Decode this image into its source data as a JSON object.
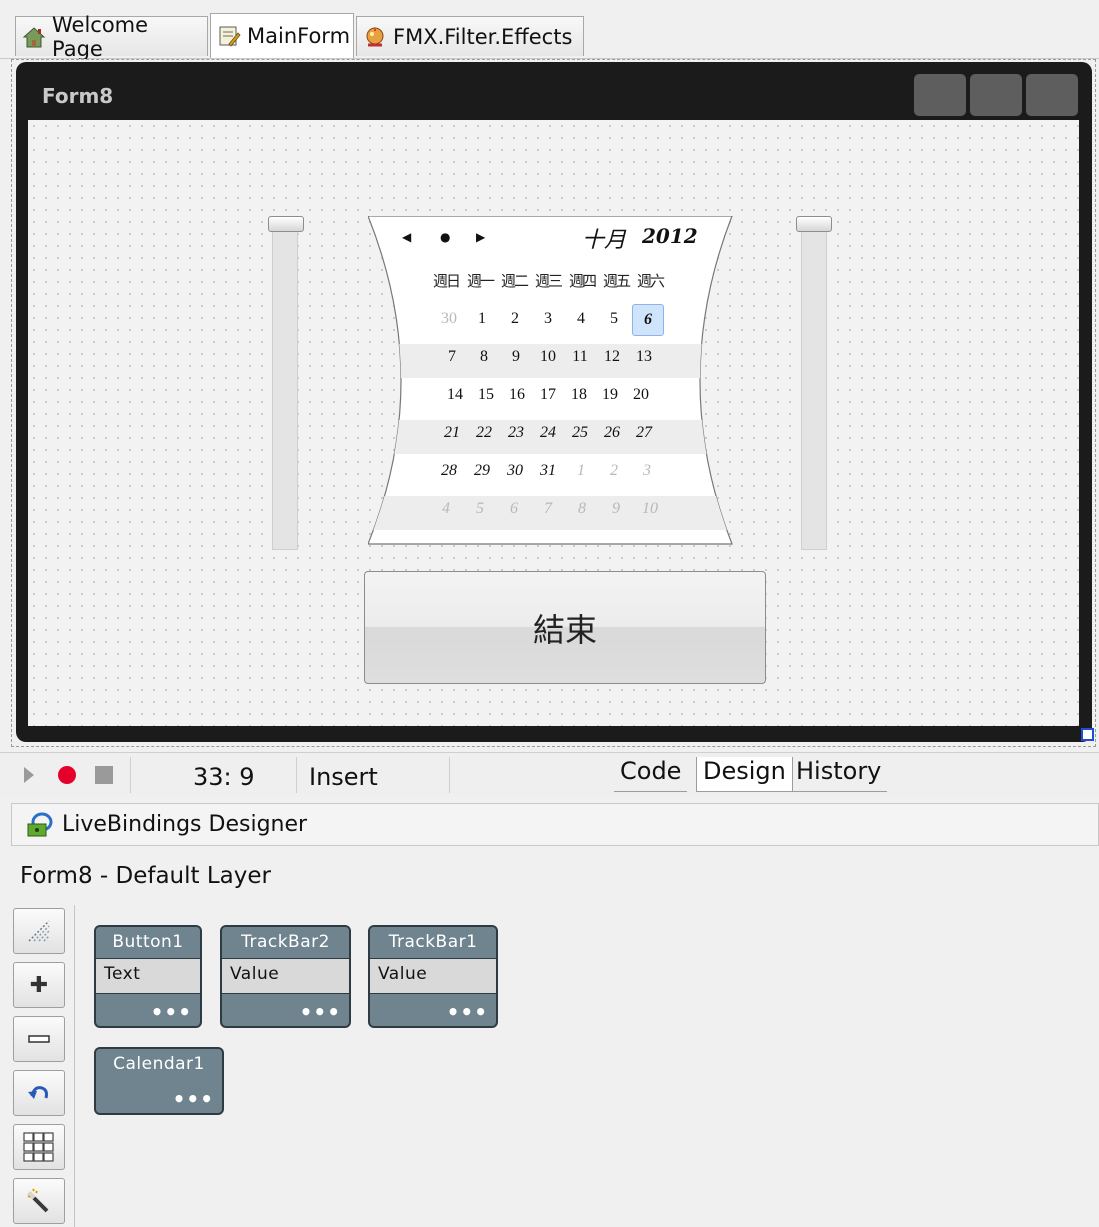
{
  "tabs": [
    {
      "label": "Welcome Page",
      "icon": "home-icon"
    },
    {
      "label": "MainForm",
      "icon": "form-icon",
      "active": true
    },
    {
      "label": "FMX.Filter.Effects",
      "icon": "effects-icon"
    }
  ],
  "form": {
    "title": "Form8",
    "calendar": {
      "month": "十月",
      "year": "2012",
      "day_names": [
        "週日",
        "週一",
        "週二",
        "週三",
        "週四",
        "週五",
        "週六"
      ],
      "weeks": [
        [
          "30",
          "1",
          "2",
          "3",
          "4",
          "5",
          "6"
        ],
        [
          "7",
          "8",
          "9",
          "10",
          "11",
          "12",
          "13"
        ],
        [
          "14",
          "15",
          "16",
          "17",
          "18",
          "19",
          "20"
        ],
        [
          "21",
          "22",
          "23",
          "24",
          "25",
          "26",
          "27"
        ],
        [
          "28",
          "29",
          "30",
          "31",
          "1",
          "2",
          "3"
        ],
        [
          "4",
          "5",
          "6",
          "7",
          "8",
          "9",
          "10"
        ]
      ],
      "selected_day": "6"
    },
    "trackbar_left_value": 0,
    "trackbar_right_value": 0,
    "end_button_label": "結束"
  },
  "statusbar": {
    "position": "33:  9",
    "mode": "Insert",
    "view_tabs": [
      "Code",
      "Design",
      "History"
    ],
    "active_view": "Design"
  },
  "livebindings": {
    "title": "LiveBindings Designer",
    "layer": "Form8  - Default Layer",
    "tool_icons": [
      "layout-icon",
      "zoom-in-icon",
      "zoom-out-icon",
      "undo-icon",
      "grid-icon",
      "wizard-icon"
    ],
    "objects": [
      {
        "name": "Button1",
        "property": "Text"
      },
      {
        "name": "TrackBar2",
        "property": "Value"
      },
      {
        "name": "TrackBar1",
        "property": "Value"
      },
      {
        "name": "Calendar1",
        "property": ""
      }
    ],
    "more_label": "•••"
  }
}
